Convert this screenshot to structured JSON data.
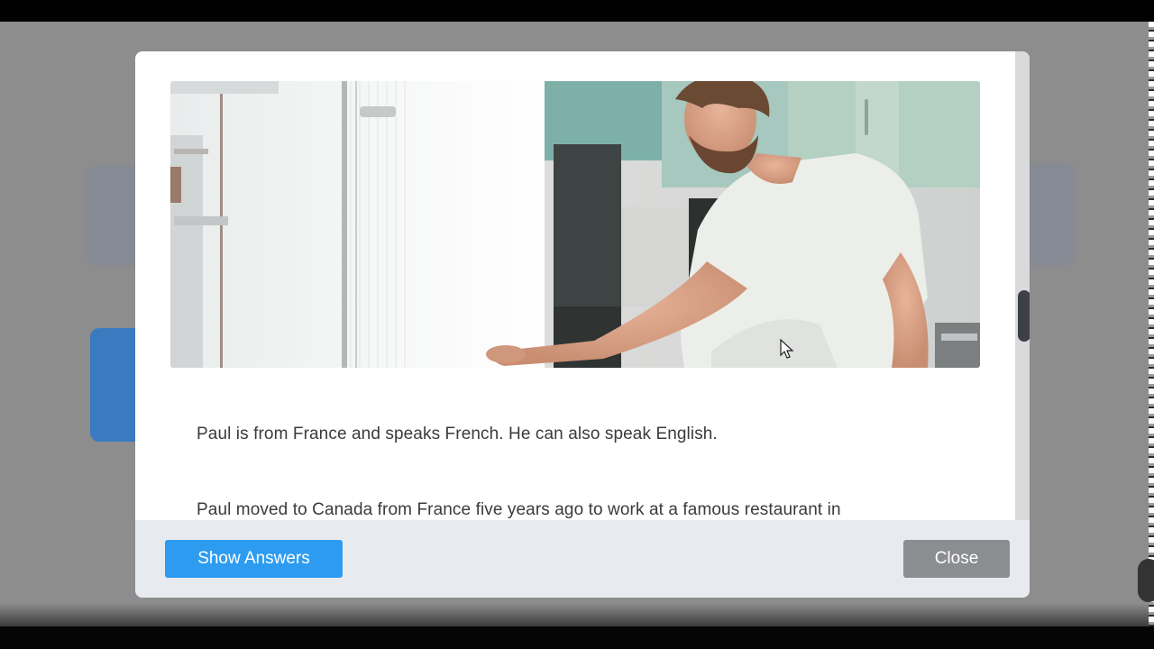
{
  "modal": {
    "paragraphs": [
      "Paul is from France and speaks French. He can also speak English.",
      "Paul moved to Canada from France five years ago to work at a famous restaurant in"
    ],
    "image": {
      "icon": "photo-man-in-kitchen-icon"
    }
  },
  "footer": {
    "show_answers_label": "Show Answers",
    "close_label": "Close"
  },
  "colors": {
    "primary_button": "#2d9cf0",
    "secondary_button": "#8b8d90",
    "footer_bg": "#e7ebef",
    "overlay": "#8d8d8d"
  }
}
